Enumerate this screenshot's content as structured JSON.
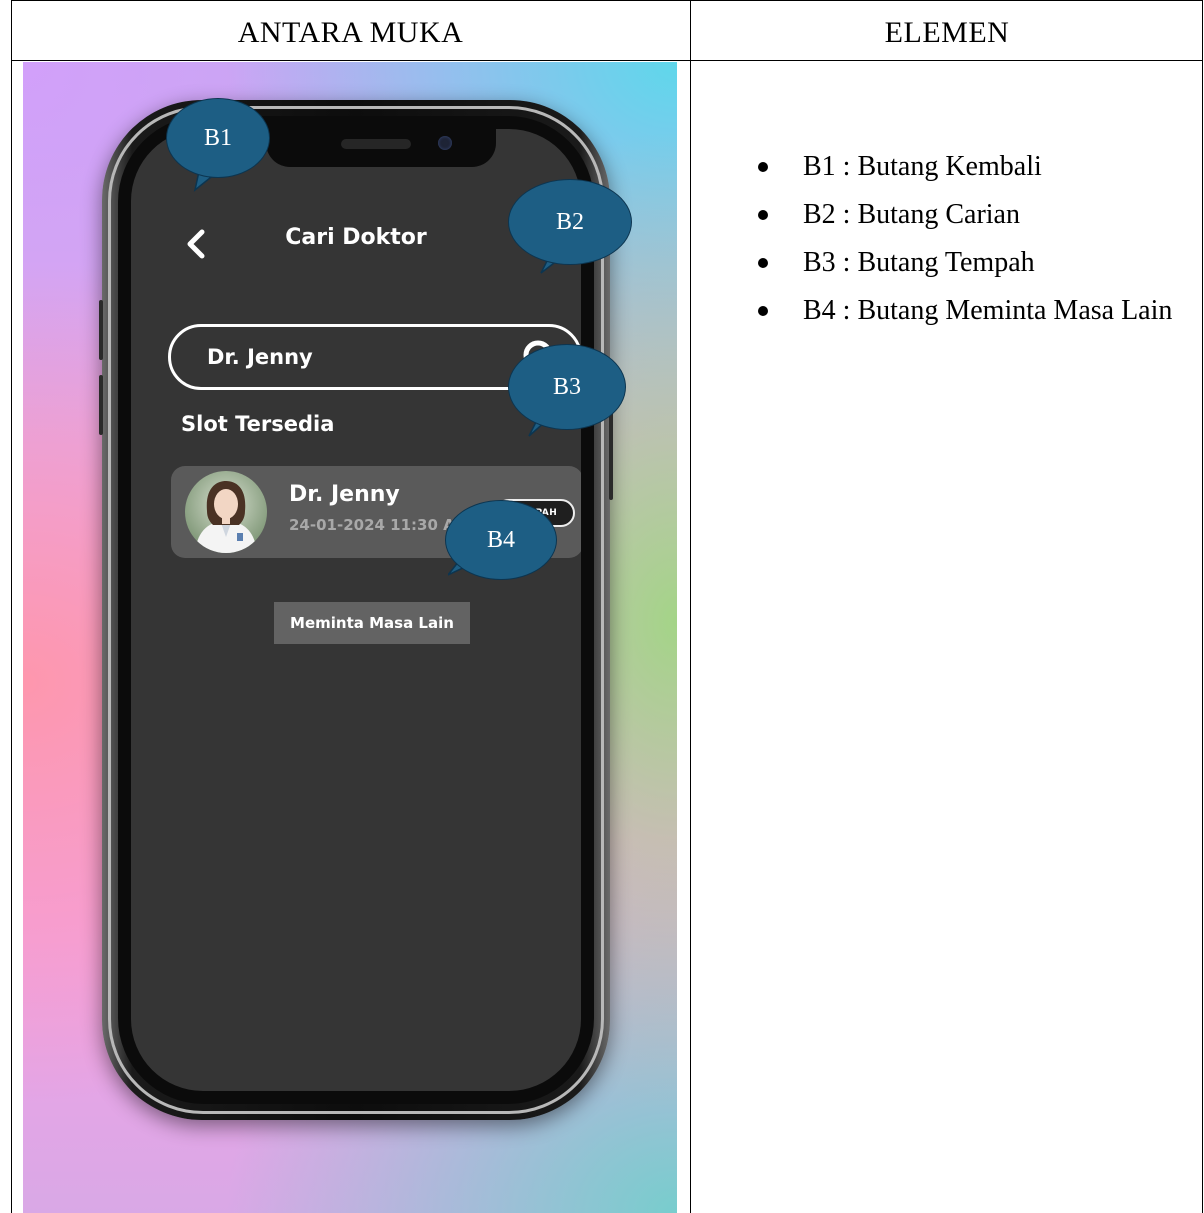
{
  "table": {
    "col1_header": "ANTARA MUKA",
    "col2_header": "ELEMEN"
  },
  "app": {
    "title": "Cari Doktor",
    "search_value": "Dr. Jenny",
    "section_title": "Slot Tersedia",
    "slot": {
      "doctor_name": "Dr. Jenny",
      "datetime": "24-01-2024 11:30 A.M",
      "book_label": "TEMPAH"
    },
    "other_time_label": "Meminta Masa Lain",
    "screen_bg": "#353535",
    "card_bg": "#5a5a5a"
  },
  "callouts": [
    {
      "id": "B1",
      "label": "B1"
    },
    {
      "id": "B2",
      "label": "B2"
    },
    {
      "id": "B3",
      "label": "B3"
    },
    {
      "id": "B4",
      "label": "B4"
    }
  ],
  "callout_color": "#1d5e84",
  "elements": [
    {
      "text": "B1 : Butang Kembali"
    },
    {
      "text": "B2 : Butang Carian"
    },
    {
      "text": "B3 : Butang Tempah"
    },
    {
      "text": "B4 : Butang Meminta Masa Lain"
    }
  ],
  "icons": {
    "back": "chevron-left-icon",
    "search": "magnifier-icon",
    "avatar": "doctor-avatar"
  }
}
